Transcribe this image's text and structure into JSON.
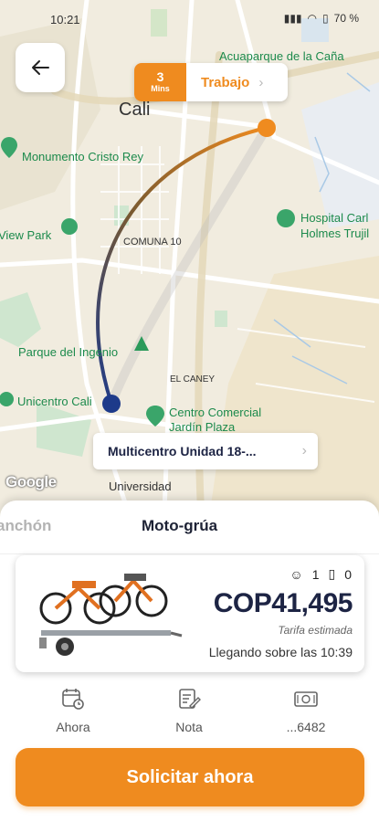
{
  "status_bar": {
    "time": "10:21",
    "battery": "70 %"
  },
  "map": {
    "labels": {
      "city": "Cali",
      "acuaparque": "Acuaparque de la Caña",
      "monumento": "Monumento Cristo Rey",
      "view_park": "View Park",
      "comuna": "COMUNA 10",
      "hospital_1": "Hospital Carl",
      "hospital_2": "Holmes Trujil",
      "parque": "Parque del Ingenio",
      "el_caney": "EL CANEY",
      "unicentro": "Unicentro Cali",
      "cc_1": "Centro Comercial",
      "cc_2": "Jardín Plaza",
      "universidad": "Universidad"
    },
    "attribution": "Google"
  },
  "eta_chip": {
    "minutes": "3",
    "unit": "Mins",
    "destination": "Trabajo"
  },
  "origin_chip": {
    "label": "Multicentro Unidad 18-..."
  },
  "tabs": {
    "previous": "anchón",
    "active": "Moto-grúa"
  },
  "vehicle_card": {
    "passengers": "1",
    "luggage": "0",
    "price": "COP41,495",
    "estimate_label": "Tarifa estimada",
    "arrival": "Llegando sobre las 10:39"
  },
  "actions": [
    {
      "label": "Ahora",
      "icon": "calendar-clock-icon"
    },
    {
      "label": "Nota",
      "icon": "note-edit-icon"
    },
    {
      "label": "...6482",
      "icon": "cash-icon"
    }
  ],
  "cta": {
    "label": "Solicitar ahora"
  },
  "colors": {
    "accent": "#ef8b1f",
    "navy": "#1d2444",
    "origin_dot": "#1d3a8a"
  }
}
